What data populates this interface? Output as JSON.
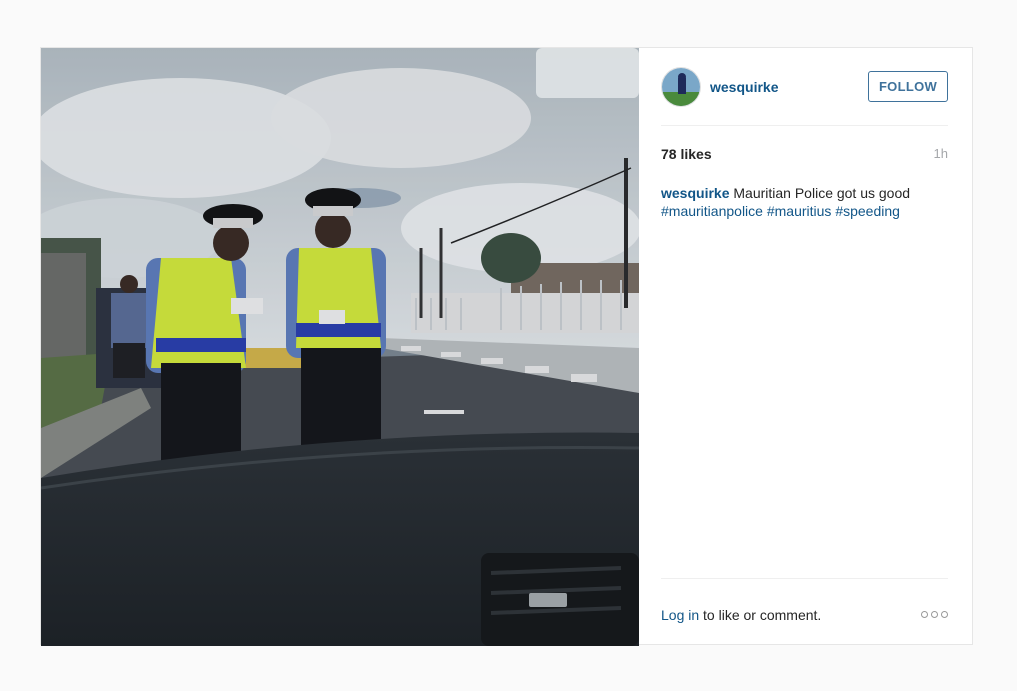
{
  "post": {
    "image_alt": "Two police officers in high-visibility vests writing a ticket beside a car, seen through a windshield",
    "user": {
      "username": "wesquirke"
    },
    "follow_label": "FOLLOW",
    "likes_label": "78 likes",
    "time_label": "1h",
    "caption": {
      "username": "wesquirke",
      "text": "Mauritian Police got us good",
      "hashtags": [
        "#mauritianpolice",
        "#mauritius",
        "#speeding"
      ]
    },
    "footer": {
      "login_link": "Log in",
      "login_rest": " to like or comment."
    }
  },
  "colors": {
    "link": "#125688",
    "follow_border": "#3f729b",
    "muted": "#a5a7aa"
  }
}
